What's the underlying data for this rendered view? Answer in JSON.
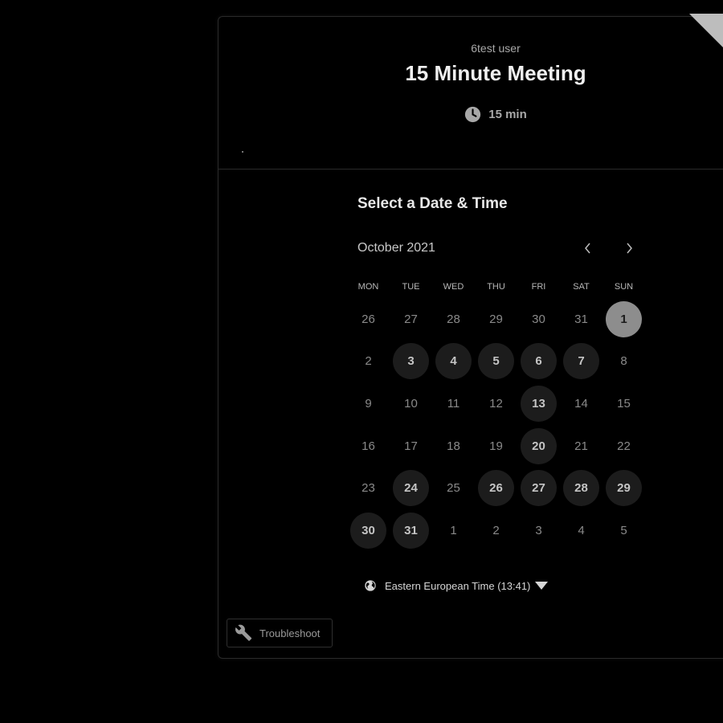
{
  "header": {
    "host_name": "6test user",
    "event_title": "15 Minute Meeting",
    "duration": "15 min",
    "duration_icon": "clock-icon"
  },
  "calendar": {
    "section_title": "Select a Date & Time",
    "month_label": "October 2021",
    "prev_icon": "chevron-left-icon",
    "next_icon": "chevron-right-icon",
    "weekdays": [
      "MON",
      "TUE",
      "WED",
      "THU",
      "FRI",
      "SAT",
      "SUN"
    ],
    "days": [
      {
        "label": "26",
        "state": "disabled"
      },
      {
        "label": "27",
        "state": "disabled"
      },
      {
        "label": "28",
        "state": "disabled"
      },
      {
        "label": "29",
        "state": "disabled"
      },
      {
        "label": "30",
        "state": "disabled"
      },
      {
        "label": "31",
        "state": "disabled"
      },
      {
        "label": "1",
        "state": "selected"
      },
      {
        "label": "2",
        "state": "disabled"
      },
      {
        "label": "3",
        "state": "available"
      },
      {
        "label": "4",
        "state": "available"
      },
      {
        "label": "5",
        "state": "available"
      },
      {
        "label": "6",
        "state": "available"
      },
      {
        "label": "7",
        "state": "available"
      },
      {
        "label": "8",
        "state": "disabled"
      },
      {
        "label": "9",
        "state": "disabled"
      },
      {
        "label": "10",
        "state": "disabled"
      },
      {
        "label": "11",
        "state": "disabled"
      },
      {
        "label": "12",
        "state": "disabled"
      },
      {
        "label": "13",
        "state": "available"
      },
      {
        "label": "14",
        "state": "disabled"
      },
      {
        "label": "15",
        "state": "disabled"
      },
      {
        "label": "16",
        "state": "disabled"
      },
      {
        "label": "17",
        "state": "disabled"
      },
      {
        "label": "18",
        "state": "disabled"
      },
      {
        "label": "19",
        "state": "disabled"
      },
      {
        "label": "20",
        "state": "available"
      },
      {
        "label": "21",
        "state": "disabled"
      },
      {
        "label": "22",
        "state": "disabled"
      },
      {
        "label": "23",
        "state": "disabled"
      },
      {
        "label": "24",
        "state": "available"
      },
      {
        "label": "25",
        "state": "disabled"
      },
      {
        "label": "26",
        "state": "available"
      },
      {
        "label": "27",
        "state": "available"
      },
      {
        "label": "28",
        "state": "available"
      },
      {
        "label": "29",
        "state": "available"
      },
      {
        "label": "30",
        "state": "available"
      },
      {
        "label": "31",
        "state": "available"
      },
      {
        "label": "1",
        "state": "disabled"
      },
      {
        "label": "2",
        "state": "disabled"
      },
      {
        "label": "3",
        "state": "disabled"
      },
      {
        "label": "4",
        "state": "disabled"
      },
      {
        "label": "5",
        "state": "disabled"
      }
    ]
  },
  "timezone": {
    "label": "Eastern European Time (13:41)",
    "icon": "globe-icon"
  },
  "troubleshoot": {
    "label": "Troubleshoot",
    "icon": "wrench-icon"
  },
  "colors": {
    "background": "#000000",
    "available_day_bg": "#1c1c1c",
    "selected_day_bg": "#8d8d8d"
  }
}
